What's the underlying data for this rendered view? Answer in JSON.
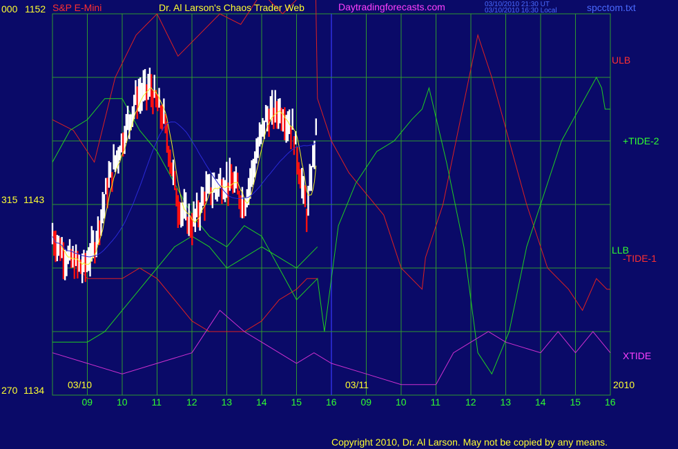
{
  "header": {
    "left_code": "000",
    "left_price": "1152",
    "symbol": "S&P E-Mini",
    "title": "Dr. Al Larson's Chaos Trader Web",
    "site": "Daytradingforecasts.com",
    "timestamp_ut": "03/10/2010 21:30 UT",
    "timestamp_local": "03/10/2010 16:30 Local",
    "file": "spcctom.txt"
  },
  "left_axis": {
    "mid_code": "315",
    "mid_price": "1143",
    "bottom_code": "270",
    "bottom_price": "1134"
  },
  "footer": {
    "copyright": "Copyright 2010, Dr. Al Larson. May not be copied by any means."
  },
  "colors": {
    "background": "#0a0a68",
    "grid": "#2f9a2f",
    "divider": "#3030e0",
    "red_lines": "#e02020",
    "green_lines": "#20d020",
    "xtide": "#d030d0",
    "price_bar": "#ffffff",
    "price_down": "#ff1010",
    "ma_yellow": "#f0f020",
    "ma_blue": "#2a2ad8",
    "label_green": "#30ff30",
    "label_red": "#ff3030",
    "label_magenta": "#ff40ff",
    "label_yellow": "#ffff30"
  },
  "chart_data": {
    "type": "line",
    "x_tick_labels": [
      "09",
      "10",
      "11",
      "12",
      "13",
      "14",
      "15",
      "16",
      "09",
      "10",
      "11",
      "12",
      "13",
      "14",
      "15",
      "16"
    ],
    "date_labels": [
      "03/10",
      "03/11",
      "2010"
    ],
    "y_range": [
      1134,
      1152
    ],
    "y_tick_values": [
      1134,
      1143,
      1152
    ],
    "grid": true,
    "series": [
      {
        "name": "ULB",
        "color": "#e02020",
        "x": [
          0,
          0.6,
          1.2,
          1.8,
          2.4,
          3.0,
          3.6,
          4.2,
          4.8,
          5.4,
          6.0,
          6.6,
          7.2,
          7.55,
          7.6,
          8.0,
          8.5,
          9.0,
          9.5,
          10.0,
          10.6,
          10.7,
          11.2,
          11.7,
          12.2,
          12.6,
          13.1,
          13.6,
          14.2,
          14.8,
          15.2,
          15.6,
          15.9,
          16.0
        ],
        "y": [
          1147,
          1146.5,
          1145,
          1149,
          1151,
          1152,
          1150,
          1151,
          1152,
          1151.5,
          1153,
          1152,
          1153,
          1153,
          1148,
          1146,
          1144.5,
          1143.5,
          1142.5,
          1140,
          1139,
          1140.5,
          1143,
          1147,
          1151,
          1149,
          1146,
          1143,
          1140,
          1139,
          1138,
          1139.5,
          1139,
          1139
        ]
      },
      {
        "name": "LLB",
        "color": "#e02020",
        "x": [
          0,
          0.5,
          1.0,
          1.5,
          2.0,
          2.5,
          3.0,
          3.5,
          4.0,
          4.5,
          5.0,
          5.5,
          6.0,
          6.5,
          7.0,
          7.3,
          7.6
        ],
        "y": [
          1141.5,
          1140.5,
          1139.5,
          1139.5,
          1139.5,
          1140,
          1139.5,
          1138.5,
          1137.5,
          1137,
          1137,
          1137,
          1137.5,
          1138.5,
          1139,
          1139.5,
          1139.5
        ]
      },
      {
        "name": "+TIDE-2",
        "color": "#20d020",
        "x": [
          0,
          0.5,
          1.0,
          1.5,
          2.0,
          2.5,
          3.0,
          3.5,
          4.0,
          4.5,
          5.0,
          5.5,
          6.0,
          6.5,
          7.0,
          7.3,
          7.6,
          7.8,
          8.2,
          8.7,
          9.3,
          9.8,
          10.3,
          10.6,
          10.8,
          11.3,
          11.8,
          12.2,
          12.6,
          13.1,
          13.6,
          14.1,
          14.6,
          15.1,
          15.6,
          15.75,
          15.85,
          16.0
        ],
        "y": [
          1145,
          1146.5,
          1147,
          1148,
          1148,
          1146.5,
          1145.5,
          1144,
          1142.5,
          1141.5,
          1141,
          1142,
          1141.5,
          1140,
          1138.5,
          1139,
          1139.5,
          1137,
          1142,
          1144,
          1145.5,
          1146,
          1147,
          1147.5,
          1148.5,
          1145,
          1141,
          1136,
          1135,
          1137,
          1141,
          1143.5,
          1146,
          1147.5,
          1149,
          1148.5,
          1147.5,
          1147.5
        ]
      },
      {
        "name": "-TIDE-1",
        "color": "#20d020",
        "x": [
          0,
          0.5,
          1.0,
          1.5,
          2.0,
          2.5,
          3.0,
          3.5,
          4.0,
          4.5,
          5.0,
          5.5,
          6.0,
          6.5,
          7.0,
          7.6
        ],
        "y": [
          1136.5,
          1136.5,
          1136.5,
          1137,
          1138,
          1139,
          1140,
          1141,
          1141.5,
          1141,
          1140,
          1140.5,
          1141,
          1140.5,
          1140,
          1141
        ]
      },
      {
        "name": "XTIDE",
        "color": "#d030d0",
        "x": [
          0,
          1,
          2,
          3,
          4,
          4.8,
          5.5,
          6,
          6.5,
          7,
          7.5,
          8,
          9,
          10,
          11,
          11.5,
          12,
          12.5,
          13,
          14,
          14.5,
          15,
          15.5,
          16
        ],
        "y": [
          1136,
          1135.5,
          1135,
          1135.5,
          1136,
          1138,
          1137,
          1136.5,
          1136,
          1135.5,
          1136,
          1135.5,
          1135,
          1134.5,
          1134.5,
          1136,
          1136.5,
          1137,
          1136.5,
          1136,
          1137,
          1136,
          1137,
          1136
        ]
      }
    ],
    "labels": {
      "ulb": "ULB",
      "tide2": "+TIDE-2",
      "llb": "LLB",
      "tide1": "-TIDE-1",
      "xtide": "XTIDE"
    }
  }
}
